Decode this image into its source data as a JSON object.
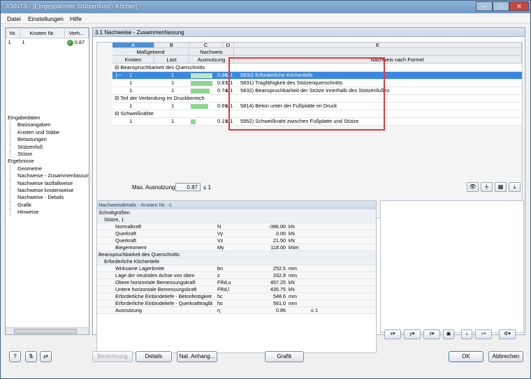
{
  "title": "JOINTS - [Eingespannter Stützenfuss - Köcher]",
  "menu": [
    "Datei",
    "Einstellungen",
    "Hilfe"
  ],
  "left_table": {
    "headers": [
      "Nr.",
      "Knoten Nr.",
      "Verh..."
    ],
    "row": {
      "nr": "1",
      "knoten": "1",
      "verh": "0.87"
    }
  },
  "tree": {
    "eingabe": "Eingabedaten",
    "eingabe_items": [
      "Basisangaben",
      "Knoten und Stäbe",
      "Belastungen",
      "Stützenfuß",
      "Stütze"
    ],
    "ergebnisse": "Ergebnisse",
    "ergebnisse_items": [
      "Geometrie",
      "Nachweise - Zusammenfassung",
      "Nachweise lastfallweise",
      "Nachweise knotenweise",
      "Nachweise - Details",
      "Grafik",
      "Hinweise"
    ]
  },
  "main_title": "3.1 Nachweise - Zusammenfassung",
  "grid": {
    "col_letters": [
      "A",
      "B",
      "C",
      "D",
      "E"
    ],
    "head1": {
      "massgebend": "Maßgebend",
      "nachweis": "Nachweis"
    },
    "head2": {
      "knoten": "Knoten",
      "last": "Last",
      "ausnutzung": "Ausnutzung",
      "formel": "Nachweis nach Formel"
    },
    "groups": [
      "Beanspruchbarkeit des Querschnitts",
      "Teil der Verbindung im Druckbereich",
      "Schweißnähte"
    ],
    "rows": [
      {
        "knoten": "1",
        "last": "1",
        "val": "0.86",
        "le": "≤ 1",
        "text": "5830) Erforderliche Köchertiefe",
        "ratio": 0.86
      },
      {
        "knoten": "1",
        "last": "1",
        "val": "0.87",
        "le": "≤ 1",
        "text": "5831) Tragfähigkeit des Stützenquerschnitts",
        "ratio": 0.87
      },
      {
        "knoten": "1",
        "last": "1",
        "val": "0.74",
        "le": "≤ 1",
        "text": "5832) Beanspruchbarkeit der Stütze innerhalb des Stützenfußes",
        "ratio": 0.74
      },
      {
        "knoten": "1",
        "last": "1",
        "val": "0.69",
        "le": "≤ 1",
        "text": "5814) Beton unter der Fußplatte im Druck",
        "ratio": 0.69
      },
      {
        "knoten": "1",
        "last": "1",
        "val": "0.19",
        "le": "≤ 1",
        "text": "5952) Schweißnaht zwischen Fußplatte und Stütze",
        "ratio": 0.19
      }
    ],
    "max_label": "Max. Ausnutzung:",
    "max_value": "0.87",
    "max_le": "≤ 1"
  },
  "details": {
    "title": "Nachweisdetails - Knoten Nr. -1",
    "g1": "Schnittgrößen",
    "g1a": "Stütze, 1",
    "r1": [
      {
        "name": "Normalkraft",
        "sym": "N",
        "val": "-396.00",
        "unit": "kN"
      },
      {
        "name": "Querkraft",
        "sym": "Vy",
        "val": "0.00",
        "unit": "kN"
      },
      {
        "name": "Querkraft",
        "sym": "Vz",
        "val": "21.50",
        "unit": "kN"
      },
      {
        "name": "Biegemoment",
        "sym": "My",
        "val": "118.00",
        "unit": "kNm"
      }
    ],
    "g2": "Beanspruchbarkeit des Querschnitts",
    "g2a": "Erforderliche Köchertiefe",
    "r2": [
      {
        "name": "Wirksame Lagerbreite",
        "sym": "bn",
        "val": "252.5",
        "unit": "mm"
      },
      {
        "name": "Lage der neutralen Achse von oben",
        "sym": "z",
        "val": "332.8",
        "unit": "mm"
      },
      {
        "name": "Obere horizontale Bemessungskraft",
        "sym": "FRd,u",
        "val": "457.25",
        "unit": "kN"
      },
      {
        "name": "Untere horizontale Bemessungskraft",
        "sym": "FRd,l",
        "val": "435.75",
        "unit": "kN"
      },
      {
        "name": "Erforderliche Einbindetiefe - Betonfestigkeit",
        "sym": "hc",
        "val": "548.6",
        "unit": "mm"
      },
      {
        "name": "Erforderliche Einbindetiefe - Querkrafttragfä",
        "sym": "hs",
        "val": "561.0",
        "unit": "mm"
      },
      {
        "name": "Ausnutzung",
        "sym": "η",
        "val": "0.86",
        "unit": "",
        "le": "≤ 1"
      }
    ]
  },
  "buttons": {
    "berechnung": "Berechnung",
    "details": "Details",
    "anhang": "Nat. Anhang...",
    "grafik": "Grafik",
    "ok": "OK",
    "abbrechen": "Abbrechen"
  },
  "colors": {
    "accent": "#3a88e0",
    "bar": "#8fd38f",
    "highlight": "#e33333"
  }
}
